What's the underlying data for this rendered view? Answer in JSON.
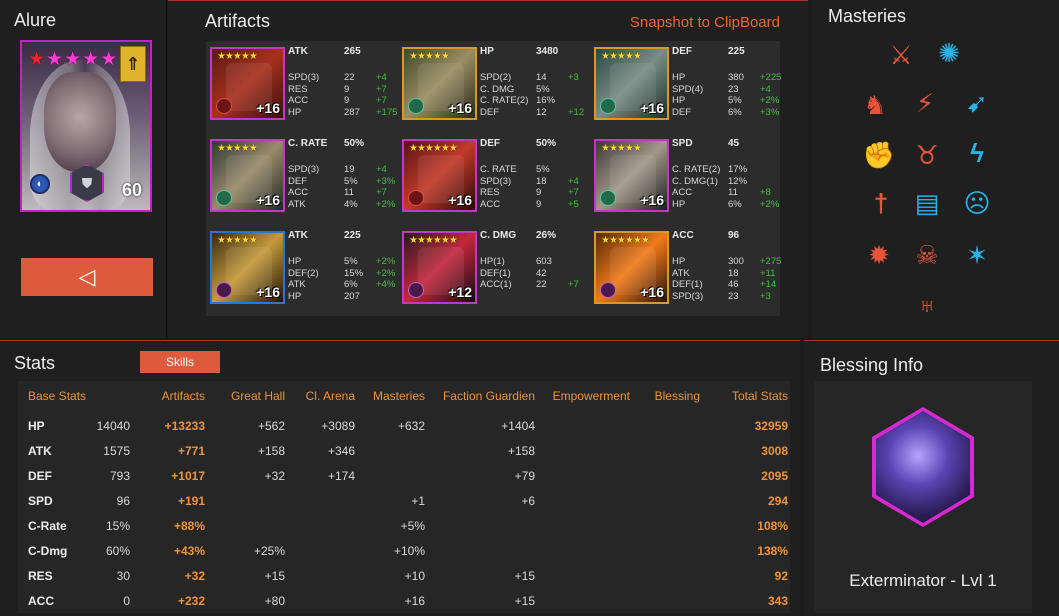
{
  "champion": {
    "name": "Alure",
    "level": "60",
    "stars": 6,
    "back_glyph": "◁"
  },
  "artifacts": {
    "title": "Artifacts",
    "snapshot_label": "Snapshot to ClipBoard",
    "items": [
      {
        "main": "ATK",
        "main_value": "265",
        "level": "+16",
        "stars": "★★★★★",
        "subs": [
          {
            "n": "SPD(3)",
            "v": "22",
            "b": "+4"
          },
          {
            "n": "RES",
            "v": "9",
            "b": "+7"
          },
          {
            "n": "ACC",
            "v": "9",
            "b": "+7"
          },
          {
            "n": "HP",
            "v": "287",
            "b": "+175"
          }
        ]
      },
      {
        "main": "HP",
        "main_value": "3480",
        "level": "+16",
        "stars": "★★★★★",
        "subs": [
          {
            "n": "SPD(2)",
            "v": "14",
            "b": "+3"
          },
          {
            "n": "C. DMG",
            "v": "5%",
            "b": ""
          },
          {
            "n": "C. RATE(2)",
            "v": "16%",
            "b": ""
          },
          {
            "n": "DEF",
            "v": "12",
            "b": "+12"
          }
        ]
      },
      {
        "main": "DEF",
        "main_value": "225",
        "level": "+16",
        "stars": "★★★★★",
        "subs": [
          {
            "n": "HP",
            "v": "380",
            "b": "+225"
          },
          {
            "n": "SPD(4)",
            "v": "23",
            "b": "+4"
          },
          {
            "n": "HP",
            "v": "5%",
            "b": "+2%"
          },
          {
            "n": "DEF",
            "v": "6%",
            "b": "+3%"
          }
        ]
      },
      {
        "main": "C. RATE",
        "main_value": "50%",
        "level": "+16",
        "stars": "★★★★★",
        "subs": [
          {
            "n": "SPD(3)",
            "v": "19",
            "b": "+4"
          },
          {
            "n": "DEF",
            "v": "5%",
            "b": "+3%"
          },
          {
            "n": "ACC",
            "v": "11",
            "b": "+7"
          },
          {
            "n": "ATK",
            "v": "4%",
            "b": "+2%"
          }
        ]
      },
      {
        "main": "DEF",
        "main_value": "50%",
        "level": "+16",
        "stars": "★★★★★★",
        "subs": [
          {
            "n": "C. RATE",
            "v": "5%",
            "b": ""
          },
          {
            "n": "SPD(3)",
            "v": "18",
            "b": "+4"
          },
          {
            "n": "RES",
            "v": "9",
            "b": "+7"
          },
          {
            "n": "ACC",
            "v": "9",
            "b": "+5"
          }
        ]
      },
      {
        "main": "SPD",
        "main_value": "45",
        "level": "+16",
        "stars": "★★★★★",
        "subs": [
          {
            "n": "C. RATE(2)",
            "v": "17%",
            "b": ""
          },
          {
            "n": "C. DMG(1)",
            "v": "12%",
            "b": ""
          },
          {
            "n": "ACC",
            "v": "11",
            "b": "+8"
          },
          {
            "n": "HP",
            "v": "6%",
            "b": "+2%"
          }
        ]
      },
      {
        "main": "ATK",
        "main_value": "225",
        "level": "+16",
        "stars": "★★★★★",
        "subs": [
          {
            "n": "HP",
            "v": "5%",
            "b": "+2%"
          },
          {
            "n": "DEF(2)",
            "v": "15%",
            "b": "+2%"
          },
          {
            "n": "ATK",
            "v": "6%",
            "b": "+4%"
          },
          {
            "n": "HP",
            "v": "207",
            "b": ""
          }
        ]
      },
      {
        "main": "C. DMG",
        "main_value": "26%",
        "level": "+12",
        "stars": "★★★★★★",
        "subs": [
          {
            "n": "HP(1)",
            "v": "603",
            "b": ""
          },
          {
            "n": "DEF(1)",
            "v": "42",
            "b": ""
          },
          {
            "n": "ACC(1)",
            "v": "22",
            "b": "+7"
          },
          {
            "n": "",
            "v": "",
            "b": ""
          }
        ]
      },
      {
        "main": "ACC",
        "main_value": "96",
        "level": "+16",
        "stars": "★★★★★★",
        "subs": [
          {
            "n": "HP",
            "v": "300",
            "b": "+275"
          },
          {
            "n": "ATK",
            "v": "18",
            "b": "+11"
          },
          {
            "n": "DEF(1)",
            "v": "46",
            "b": "+14"
          },
          {
            "n": "SPD(3)",
            "v": "23",
            "b": "+3"
          }
        ]
      }
    ]
  },
  "masteries": {
    "title": "Masteries"
  },
  "stats": {
    "title": "Stats",
    "skills_label": "Skills",
    "headers": {
      "base": "Base Stats",
      "artifacts": "Artifacts",
      "great_hall": "Great Hall",
      "arena": "Cl. Arena",
      "masteries": "Masteries",
      "faction": "Faction Guardien",
      "empowerment": "Empowerment",
      "blessing": "Blessing",
      "total": "Total Stats"
    },
    "rows": [
      {
        "label": "HP",
        "base": "14040",
        "artifacts": "+13233",
        "great_hall": "+562",
        "arena": "+3089",
        "masteries": "+632",
        "faction": "+1404",
        "total": "32959"
      },
      {
        "label": "ATK",
        "base": "1575",
        "artifacts": "+771",
        "great_hall": "+158",
        "arena": "+346",
        "masteries": "",
        "faction": "+158",
        "total": "3008"
      },
      {
        "label": "DEF",
        "base": "793",
        "artifacts": "+1017",
        "great_hall": "+32",
        "arena": "+174",
        "masteries": "",
        "faction": "+79",
        "total": "2095"
      },
      {
        "label": "SPD",
        "base": "96",
        "artifacts": "+191",
        "great_hall": "",
        "arena": "",
        "masteries": "+1",
        "faction": "+6",
        "total": "294"
      },
      {
        "label": "C-Rate",
        "base": "15%",
        "artifacts": "+88%",
        "great_hall": "",
        "arena": "",
        "masteries": "+5%",
        "faction": "",
        "total": "108%"
      },
      {
        "label": "C-Dmg",
        "base": "60%",
        "artifacts": "+43%",
        "great_hall": "+25%",
        "arena": "",
        "masteries": "+10%",
        "faction": "",
        "total": "138%"
      },
      {
        "label": "RES",
        "base": "30",
        "artifacts": "+32",
        "great_hall": "+15",
        "arena": "",
        "masteries": "+10",
        "faction": "+15",
        "total": "92"
      },
      {
        "label": "ACC",
        "base": "0",
        "artifacts": "+232",
        "great_hall": "+80",
        "arena": "",
        "masteries": "+16",
        "faction": "+15",
        "total": "343"
      }
    ]
  },
  "blessing": {
    "title": "Blessing Info",
    "name": "Exterminator - Lvl 1"
  }
}
